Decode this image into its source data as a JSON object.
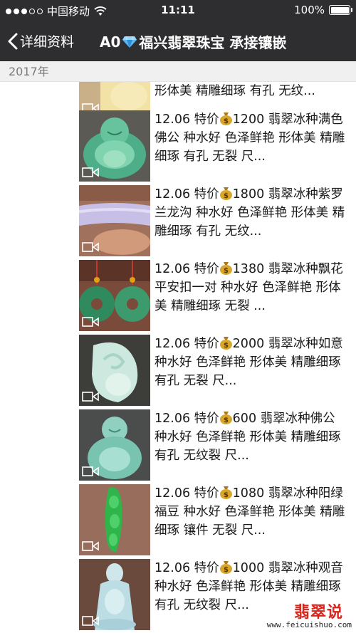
{
  "status_bar": {
    "carrier": "中国移动",
    "time": "11:11",
    "battery": "100%",
    "signal_bars_filled": 3,
    "signal_bars_total": 5
  },
  "nav": {
    "back_label": "详细资料",
    "title_prefix": "A0",
    "title_icon": "gem-icon",
    "title_text": "福兴翡翠珠宝 承接镶嵌"
  },
  "year_header": "2017年",
  "posts": [
    {
      "line1": "12.06 特价",
      "price": "1200",
      "rest": "翡翠冰种满色佛公 种水好 色泽鲜艳 形体美 精雕细琢 有孔 无裂 尺...",
      "thumb": "green-buddha",
      "video": true
    },
    {
      "line1": "12.06 特价",
      "price": "1800",
      "rest": "翡翠冰种紫罗兰龙沟 种水好 色泽鲜艳 形体美 精雕细琢 有孔 无纹...",
      "thumb": "lavender-bangle",
      "video": true
    },
    {
      "line1": "12.06 特价",
      "price": "1380",
      "rest": "翡翠冰种飘花平安扣一对 种水好 色泽鲜艳 形体美 精雕细琢 无裂 ...",
      "thumb": "safety-buckles",
      "video": true
    },
    {
      "line1": "12.06 特价",
      "price": "2000",
      "rest": "翡翠冰种如意 种水好 色泽鲜艳 形体美 精雕细琢 有孔 无裂 尺...",
      "thumb": "ruyi",
      "video": true
    },
    {
      "line1": "12.06 特价",
      "price": "600",
      "rest": "翡翠冰种佛公 种水好 色泽鲜艳 形体美 精雕细琢 有孔 无纹裂 尺...",
      "thumb": "ice-buddha",
      "video": true
    },
    {
      "line1": "12.06 特价",
      "price": "1080",
      "rest": "翡翠冰种阳绿福豆 种水好 色泽鲜艳 形体美 精雕细琢 镶件 无裂 尺...",
      "thumb": "green-bean",
      "video": true
    },
    {
      "line1": "12.06 特价",
      "price": "1000",
      "rest": "翡翠冰种观音 种水好 色泽鲜艳 形体美 精雕细琢 有孔 无纹裂 尺...",
      "thumb": "guanyin",
      "video": true
    }
  ],
  "partial_post_text": "形体美 精雕细琢 有孔 无纹...",
  "watermark": {
    "title": "翡翠说",
    "url": "www.feicuishuo.com"
  }
}
